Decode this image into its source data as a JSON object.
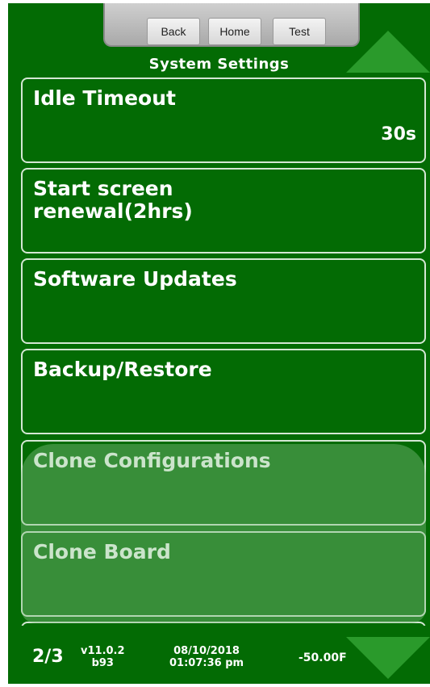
{
  "nav": {
    "back_label": "Back",
    "home_label": "Home",
    "test_label": "Test"
  },
  "title": "System Settings",
  "items": [
    {
      "label": "Idle Timeout",
      "value": "30s"
    },
    {
      "label": "Start screen renewal(2hrs)"
    },
    {
      "label": "Software Updates"
    },
    {
      "label": "Backup/Restore"
    },
    {
      "label": "Clone Configurations"
    },
    {
      "label": "Clone Board"
    }
  ],
  "footer": {
    "page": "2/3",
    "version": "v11.0.2",
    "build": "b93",
    "date": "08/10/2018",
    "time": "01:07:36 pm",
    "temperature": "-50.00F"
  },
  "colors": {
    "background": "#036b04",
    "arrow": "#2a9a2b",
    "border": "#d4e7d4",
    "text": "#ffffff"
  },
  "icons": {
    "scroll_up": "arrow-up-icon",
    "scroll_down": "arrow-down-icon"
  }
}
